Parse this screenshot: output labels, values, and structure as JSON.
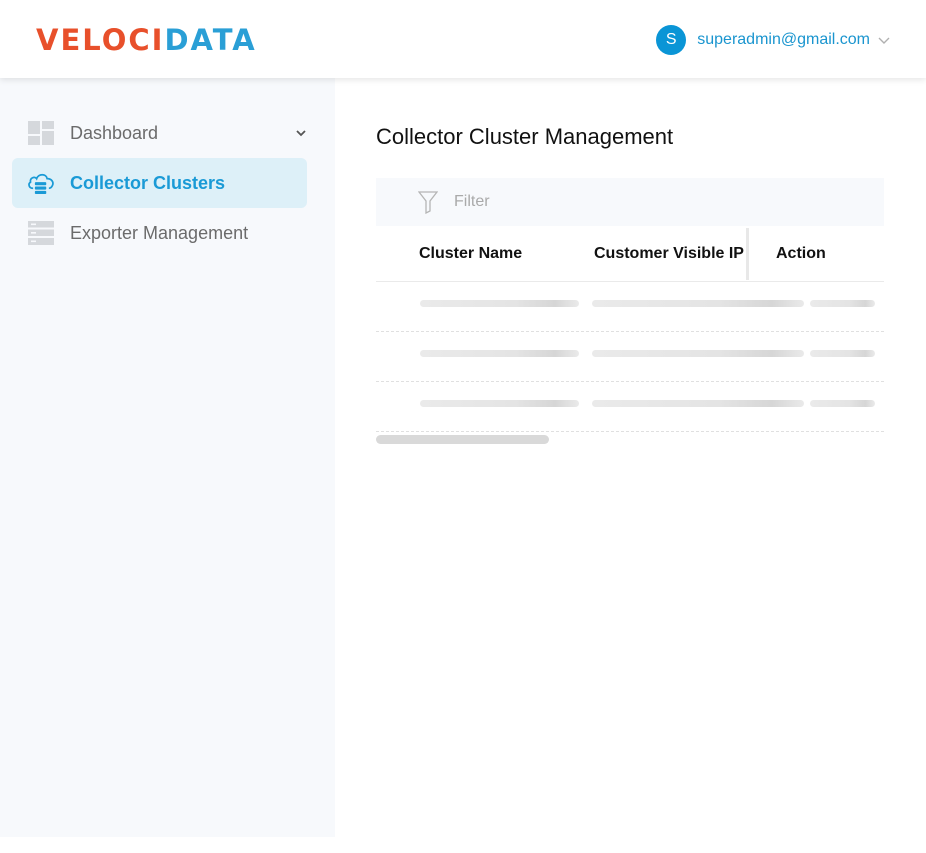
{
  "brand": {
    "part1": "VELOCI",
    "part2": "DATA"
  },
  "user": {
    "initial": "S",
    "email": "superadmin@gmail.com"
  },
  "sidebar": {
    "items": [
      {
        "label": "Dashboard",
        "icon": "dashboard-icon",
        "active": false,
        "expandable": true
      },
      {
        "label": "Collector Clusters",
        "icon": "cloud-server-icon",
        "active": true
      },
      {
        "label": "Exporter Management",
        "icon": "server-rack-icon",
        "active": false
      }
    ]
  },
  "main": {
    "title": "Collector Cluster Management",
    "filter": {
      "placeholder": "Filter"
    },
    "table": {
      "columns": [
        "Cluster Name",
        "Customer Visible IP",
        "Action"
      ],
      "loading_rows": 3
    }
  },
  "colors": {
    "brand_orange": "#e8502b",
    "brand_blue": "#2a9fd6",
    "accent": "#1a9ad6",
    "active_bg": "#ddf0f8",
    "sidebar_bg": "#f7f9fc"
  }
}
